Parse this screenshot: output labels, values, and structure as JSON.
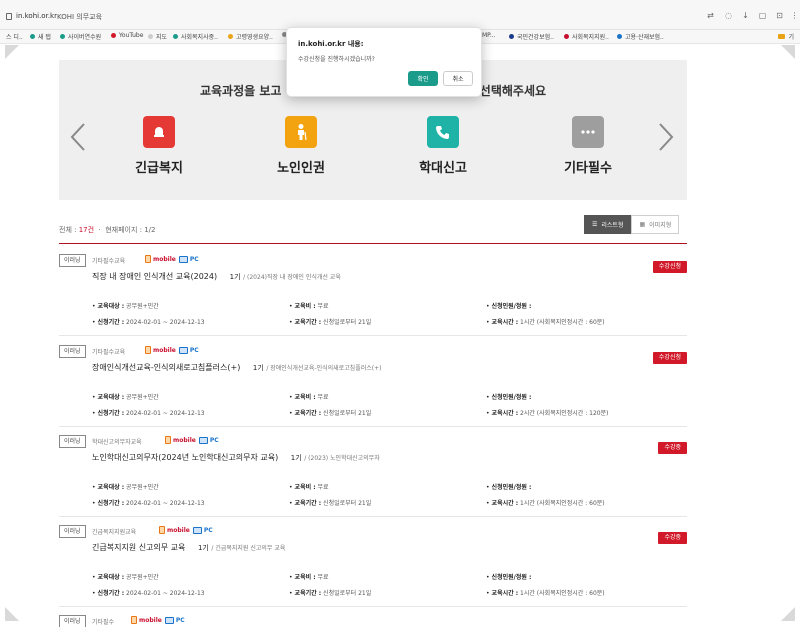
{
  "browser": {
    "url": "in.kohi.or.kr",
    "tab_title": "KOHI 의무교육",
    "bookmarks": [
      {
        "label": "스 디..",
        "color": "#1a73c8"
      },
      {
        "label": "새 탭",
        "color": "#1b9c8a"
      },
      {
        "label": "사이버연수원",
        "color": "#1b9c8a"
      },
      {
        "label": "YouTube",
        "color": "#d1192a"
      },
      {
        "label": "지도",
        "color": "#cccccc"
      },
      {
        "label": "사회복지사중..",
        "color": "#1b9c8a"
      },
      {
        "label": "고령영생요양..",
        "color": "#e8a317"
      },
      {
        "label": "",
        "color": "#888888"
      },
      {
        "label": "MP...",
        "color": "#888888"
      },
      {
        "label": "국민건강보험..",
        "color": "#1a3a8c"
      },
      {
        "label": "사회복지지원..",
        "color": "#c8102e"
      },
      {
        "label": "고용·산재보험..",
        "color": "#1a73c8"
      }
    ],
    "bookmarks_folder": "기"
  },
  "category_panel": {
    "title_left": "교육과정을 보고",
    "title_right": "선택해주세요",
    "categories": [
      {
        "label": "긴급복지",
        "icon": "bell-icon",
        "color": "#e53935"
      },
      {
        "label": "노인인권",
        "icon": "elderly-icon",
        "color": "#f2a30f"
      },
      {
        "label": "학대신고",
        "icon": "phone-icon",
        "color": "#1fb2a6"
      },
      {
        "label": "기타필수",
        "icon": "more-icon",
        "color": "#9e9e9e"
      }
    ]
  },
  "list_summary": {
    "total_label": "전체 :",
    "total_count": "17건",
    "page_label": "현재페이지 : 1/2"
  },
  "view_toggle": {
    "list_label": "리스트형",
    "image_label": "이미지형"
  },
  "courses": [
    {
      "type": "이러닝",
      "category": "기타필수교육",
      "mobile": "mobile",
      "pc": "PC",
      "title": "직장 내 장애인 인식개선 교육(2024)",
      "term": "1기",
      "term_sub": "/ (2024)직장 내 장애인 인식개선 교육",
      "status": "수강신청",
      "target_label": "교육대상 :",
      "target": "공무원+민간",
      "fee_label": "교육비 :",
      "fee": "무료",
      "applicants_label": "신청인원/정원 :",
      "applicants": "",
      "period_label": "신청기간 :",
      "period": "2024-02-01 ~ 2024-12-13",
      "duration_label": "교육기간 :",
      "duration": "신청일로부터 21일",
      "hours_label": "교육시간 :",
      "hours": "1시간 (사회복지인정시간 : 60분)"
    },
    {
      "type": "이러닝",
      "category": "기타필수교육",
      "mobile": "mobile",
      "pc": "PC",
      "title": "장애인식개선교육-인식의새로고침플러스(+)",
      "term": "1기",
      "term_sub": "/ 장애인식개선교육-인식의새로고침플러스(+)",
      "status": "수강신청",
      "target_label": "교육대상 :",
      "target": "공무원+민간",
      "fee_label": "교육비 :",
      "fee": "무료",
      "applicants_label": "신청인원/정원 :",
      "applicants": "",
      "period_label": "신청기간 :",
      "period": "2024-02-01 ~ 2024-12-13",
      "duration_label": "교육기간 :",
      "duration": "신청일로부터 21일",
      "hours_label": "교육시간 :",
      "hours": "2시간 (사회복지인정시간 : 120분)"
    },
    {
      "type": "이러닝",
      "category": "학대신고의무자교육",
      "mobile": "mobile",
      "pc": "PC",
      "title": "노인학대신고의무자(2024년 노인학대신고의무자 교육)",
      "term": "1기",
      "term_sub": "/ (2023) 노인학대신고의무자",
      "status": "수강중",
      "target_label": "교육대상 :",
      "target": "공무원+민간",
      "fee_label": "교육비 :",
      "fee": "무료",
      "applicants_label": "신청인원/정원 :",
      "applicants": "",
      "period_label": "신청기간 :",
      "period": "2024-02-01 ~ 2024-12-13",
      "duration_label": "교육기간 :",
      "duration": "신청일로부터 21일",
      "hours_label": "교육시간 :",
      "hours": "1시간 (사회복지인정시간 : 60분)"
    },
    {
      "type": "이러닝",
      "category": "긴급복지지원교육",
      "mobile": "mobile",
      "pc": "PC",
      "title": "긴급복지지원 신고의무 교육",
      "term": "1기",
      "term_sub": "/ 긴급복지지원 신고의무 교육",
      "status": "수강중",
      "target_label": "교육대상 :",
      "target": "공무원+민간",
      "fee_label": "교육비 :",
      "fee": "무료",
      "applicants_label": "신청인원/정원 :",
      "applicants": "",
      "period_label": "신청기간 :",
      "period": "2024-02-01 ~ 2024-12-13",
      "duration_label": "교육기간 :",
      "duration": "신청일로부터 21일",
      "hours_label": "교육시간 :",
      "hours": "1시간 (사회복지인정시간 : 60분)"
    },
    {
      "type": "이러닝",
      "category": "기타필수",
      "mobile": "mobile",
      "pc": "PC"
    }
  ],
  "dialog": {
    "title": "in.kohi.or.kr 내용:",
    "message": "수강신청을 진행하시겠습니까?",
    "ok_label": "확인",
    "cancel_label": "취소"
  }
}
